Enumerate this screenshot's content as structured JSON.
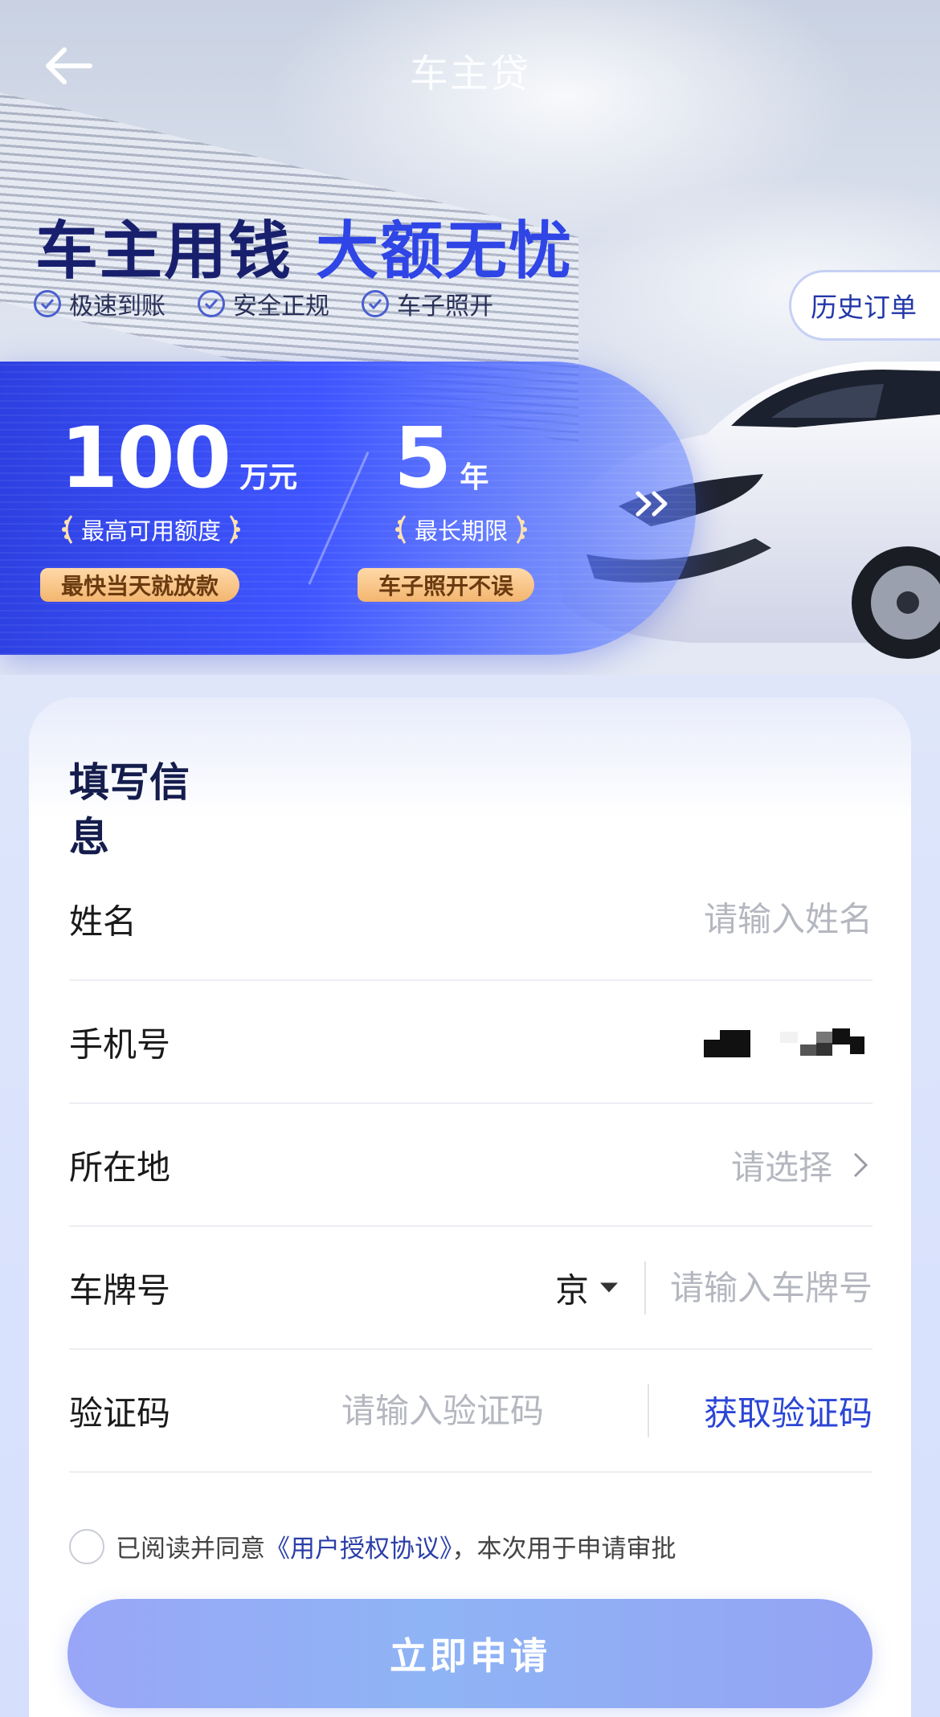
{
  "nav": {
    "title": "车主贷"
  },
  "banner": {
    "slogan_dark": "车主用钱",
    "slogan_blue": "大额无忧",
    "features": [
      "极速到账",
      "安全正规",
      "车子照开"
    ],
    "history_button": "历史订单"
  },
  "promo": {
    "amount_value": "100",
    "amount_unit": "万元",
    "amount_label": "最高可用额度",
    "amount_tag": "最快当天就放款",
    "term_value": "5",
    "term_unit": "年",
    "term_label": "最长期限",
    "term_tag": "车子照开不误"
  },
  "form": {
    "title": "填写信息",
    "name_label": "姓名",
    "name_placeholder": "请输入姓名",
    "phone_label": "手机号",
    "location_label": "所在地",
    "location_placeholder": "请选择",
    "plate_label": "车牌号",
    "plate_province": "京",
    "plate_placeholder": "请输入车牌号",
    "code_label": "验证码",
    "code_placeholder": "请输入验证码",
    "get_code_button": "获取验证码",
    "agreement_prefix": "已阅读并同意",
    "agreement_link": "《用户授权协议》",
    "agreement_suffix": "，本次用于申请审批",
    "submit_button": "立即申请"
  },
  "colors": {
    "brand_blue": "#2f45e6",
    "navy_text": "#18206e",
    "link_blue": "#2c46d6",
    "submit_gradient_start": "#99a6f7"
  }
}
